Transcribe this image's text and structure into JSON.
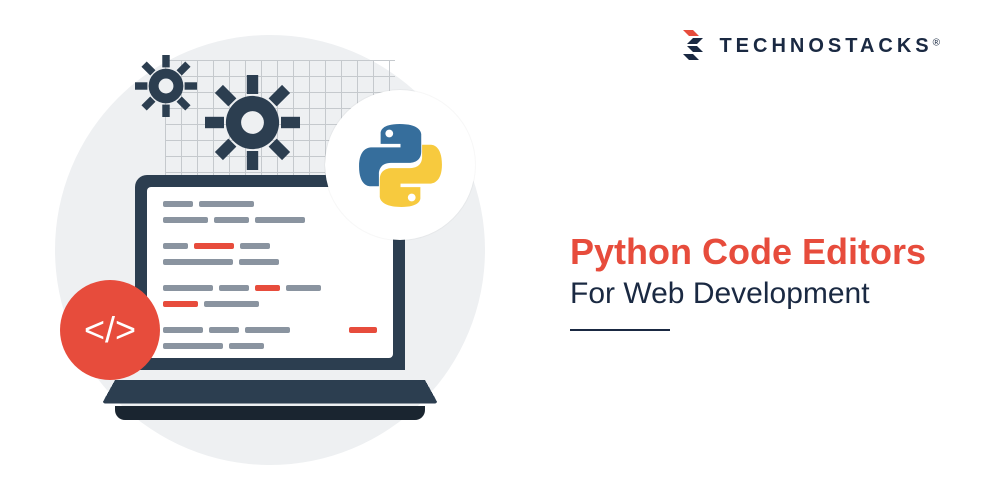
{
  "brand": {
    "name": "TECHNOSTACKS",
    "registered_symbol": "®"
  },
  "headline": {
    "line1": "Python Code Editors",
    "line2": "For Web Development"
  },
  "badges": {
    "code_symbol": "</>"
  },
  "colors": {
    "accent_red": "#e74c3c",
    "navy": "#1a2942",
    "bg_circle": "#eef0f2",
    "python_blue": "#366e9c",
    "python_yellow": "#f7ca3e"
  }
}
